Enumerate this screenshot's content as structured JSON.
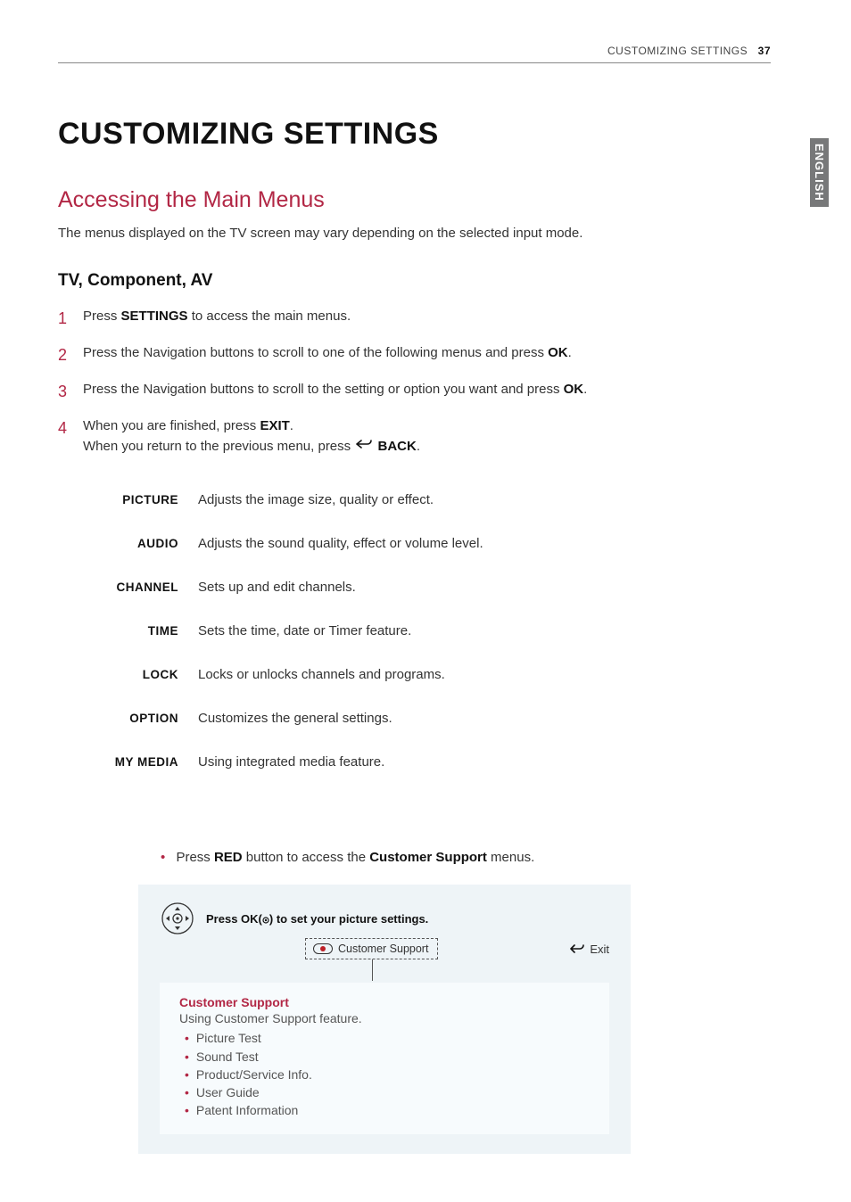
{
  "header": {
    "section": "CUSTOMIZING SETTINGS",
    "page": "37"
  },
  "sideTab": "ENGLISH",
  "h1": "CUSTOMIZING SETTINGS",
  "h2": "Accessing the Main Menus",
  "intro": "The menus displayed on the TV screen may vary depending on the selected input mode.",
  "h3": "TV, Component, AV",
  "steps": {
    "s1": {
      "num": "1",
      "pre": "Press ",
      "bold": "SETTINGS",
      "post": " to access the main menus."
    },
    "s2": {
      "num": "2",
      "pre": "Press the Navigation buttons to scroll to one of the following menus and press ",
      "bold": "OK",
      "post": "."
    },
    "s3": {
      "num": "3",
      "pre": "Press the Navigation buttons to scroll to the setting or option you want and press ",
      "bold": "OK",
      "post": "."
    },
    "s4": {
      "num": "4",
      "line1_pre": "When you are finished, press ",
      "line1_bold": "EXIT",
      "line1_post": ".",
      "line2_pre": "When you return to the previous menu, press ",
      "line2_bold": "BACK",
      "line2_post": "."
    }
  },
  "menuItems": [
    {
      "name": "PICTURE",
      "desc": "Adjusts the image size, quality or effect."
    },
    {
      "name": "AUDIO",
      "desc": "Adjusts the sound quality, effect or volume level."
    },
    {
      "name": "CHANNEL",
      "desc": "Sets up and edit channels."
    },
    {
      "name": "TIME",
      "desc": "Sets the time, date or  Timer feature."
    },
    {
      "name": "LOCK",
      "desc": "Locks or unlocks channels and programs."
    },
    {
      "name": "OPTION",
      "desc": "Customizes the general settings."
    },
    {
      "name": "MY MEDIA",
      "desc": "Using integrated media  feature."
    }
  ],
  "redNote": {
    "pre": "Press ",
    "bold1": "RED",
    "mid": " button to access the ",
    "bold2": "Customer Support",
    "post": " menus."
  },
  "osd": {
    "titlePre": "Press OK(",
    "titlePost": ") to set your picture settings.",
    "csButton": "Customer Support",
    "exit": "Exit",
    "lower": {
      "head": "Customer Support",
      "sub": "Using Customer Support feature.",
      "items": [
        "Picture Test",
        "Sound Test",
        "Product/Service Info.",
        "User Guide",
        "Patent Information"
      ]
    }
  }
}
